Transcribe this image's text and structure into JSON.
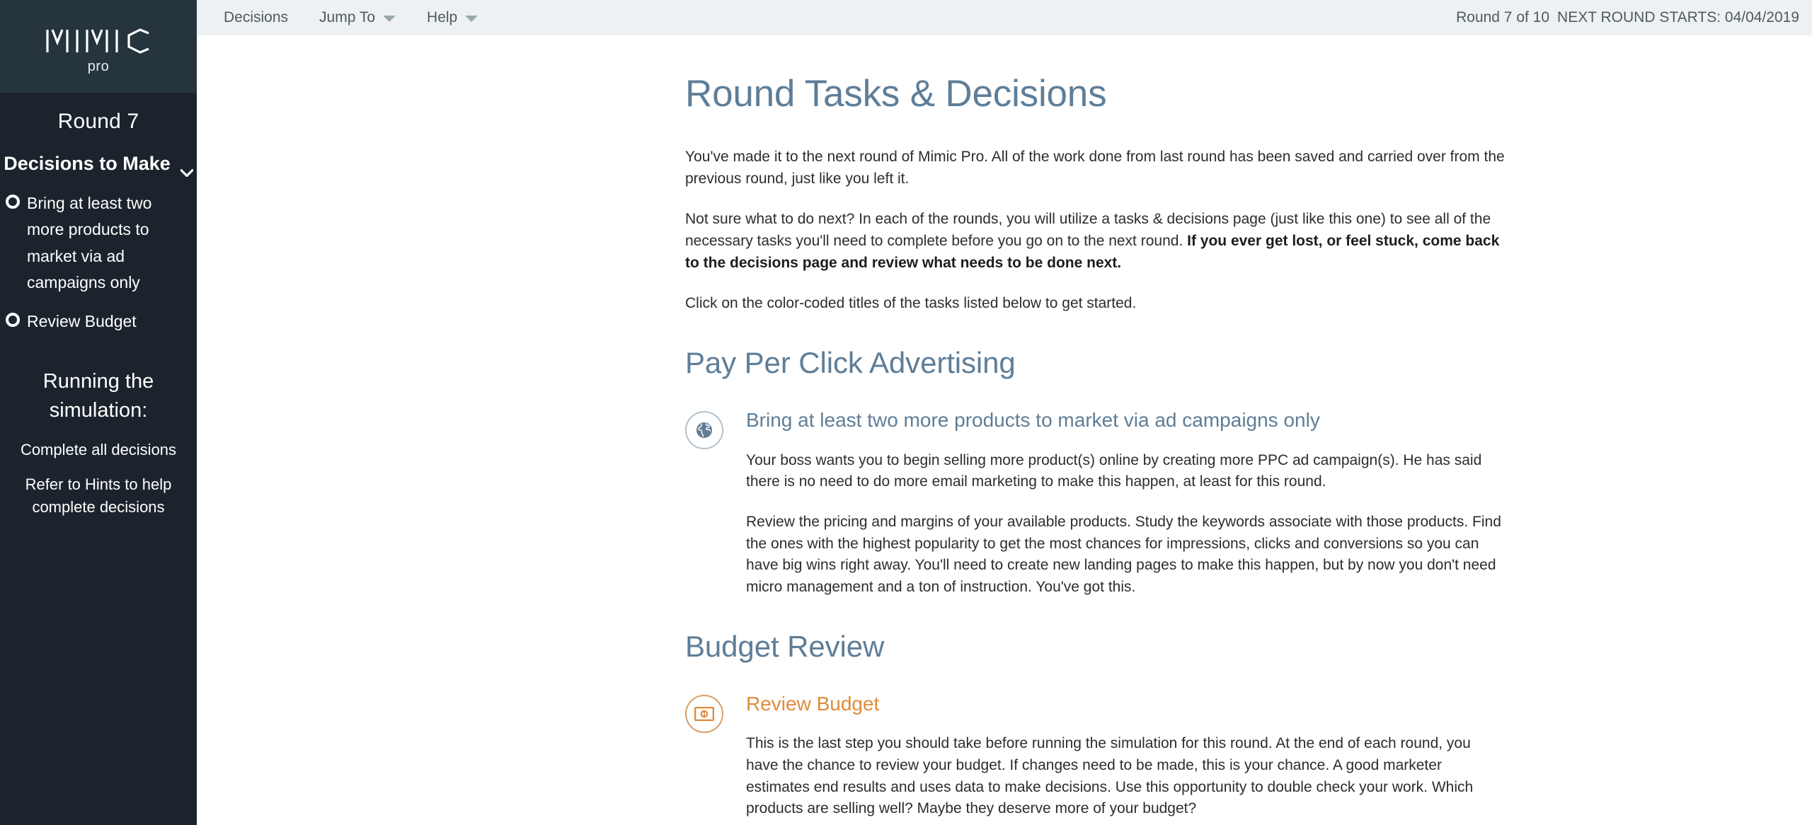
{
  "brand": {
    "logo_text": "MIMIC",
    "logo_sub": "pro"
  },
  "sidebar": {
    "round_title": "Round 7",
    "decisions_header": "Decisions to Make",
    "chevron_icon": "chevron-down-icon",
    "decisions": [
      {
        "label": "Bring at least two more products to market via ad campaigns only",
        "icon": "circle-outline-icon"
      },
      {
        "label": "Review Budget",
        "icon": "circle-outline-icon"
      }
    ],
    "running_title": "Running the simulation:",
    "running_steps": [
      "Complete all decisions",
      "Refer to Hints to help complete decisions"
    ]
  },
  "topbar": {
    "nav": [
      {
        "label": "Decisions",
        "has_caret": false
      },
      {
        "label": "Jump To",
        "has_caret": true
      },
      {
        "label": "Help",
        "has_caret": true
      }
    ],
    "round_counter": "Round 7 of 10",
    "next_round": "NEXT ROUND STARTS: 04/04/2019"
  },
  "main": {
    "page_title": "Round Tasks & Decisions",
    "intro": [
      "You've made it to the next round of Mimic Pro. All of the work done from last round has been saved and carried over from the previous round, just like you left it.",
      "Click on the color-coded titles of the tasks listed below to get started."
    ],
    "intro_rich": {
      "lead": "Not sure what to do next? In each of the rounds, you will utilize a tasks & decisions page (just like this one) to see all of the necessary tasks you'll need to complete before you go on to the next round. ",
      "bold": "If you ever get lost, or feel stuck, come back to the decisions page and review what needs to be done next."
    },
    "sections": [
      {
        "title": "Pay Per Click Advertising",
        "task_title": "Bring at least two more products to market via ad campaigns only",
        "icon": "globe-icon",
        "accent": "#5f7d96",
        "paragraphs": [
          "Your boss wants you to begin selling more product(s) online by creating more PPC ad campaign(s). He has said there is no need to do more email marketing to make this happen, at least for this round.",
          "Review the pricing and margins of your available products. Study the keywords associate with those products. Find the ones with the highest popularity to get the most chances for impressions, clicks and conversions so you can have big wins right away. You'll need to create new landing pages to make this happen, but by now you don't need micro management and a ton of instruction. You've got this."
        ]
      },
      {
        "title": "Budget Review",
        "task_title": "Review Budget",
        "icon": "money-bill-icon",
        "accent": "#e08b3c",
        "paragraphs": [
          "This is the last step you should take before running the simulation for this round. At the end of each round, you have the chance to review your budget. If changes need to be made, this is your chance. A good marketer estimates end results and uses data to make decisions. Use this opportunity to double check your work. Which products are selling well? Maybe they deserve more of your budget?"
        ]
      }
    ]
  },
  "colors": {
    "sidebar_bg": "#1b242c",
    "logo_bg": "#25343d",
    "topbar_bg": "#eef1f3",
    "heading_blue": "#5e7e98",
    "accent_orange": "#e08b3c",
    "body_text": "#2d2d2d"
  }
}
